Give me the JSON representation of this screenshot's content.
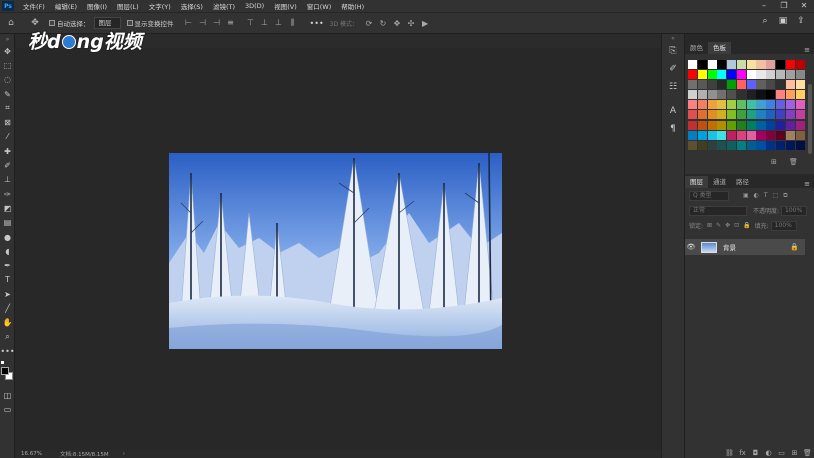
{
  "menubar": {
    "logo": "Ps",
    "items": [
      "文件(F)",
      "编辑(E)",
      "图像(I)",
      "图层(L)",
      "文字(Y)",
      "选择(S)",
      "滤镜(T)",
      "3D(D)",
      "视图(V)",
      "窗口(W)",
      "帮助(H)"
    ],
    "window_controls": [
      "–",
      "❐",
      "✕"
    ]
  },
  "options": {
    "auto_select_label": "自动选择：",
    "auto_select_value": "图层",
    "show_transform_label": "显示变换控件",
    "more": "•••",
    "mode_3d": "3D 模式："
  },
  "watermark": "秒d ng视频",
  "document": {
    "image_subject": "snowy-forest-photo"
  },
  "statusbar": {
    "zoom": "16.67%",
    "doc_info": "文档:8.15M/8.15M"
  },
  "panels": {
    "color_tabs": [
      "颜色",
      "色板"
    ],
    "color_active_tab": "色板",
    "layer_tabs": [
      "图层",
      "通道",
      "路径"
    ],
    "layer_active_tab": "图层",
    "kind_placeholder": "Q 类型",
    "blend_mode": "正常",
    "opacity_label": "不透明度:",
    "opacity_value": "100%",
    "lock_label": "锁定:",
    "fill_label": "填充:",
    "fill_value": "100%",
    "layer_name": "背景"
  },
  "swatch_colors": [
    [
      "#ffffff",
      "#000000",
      "#ffffff",
      "#000000",
      "#b0c8d8",
      "#c8e0a8",
      "#f8e0a0",
      "#f0c0a0",
      "#e0a0a0",
      "#000000",
      "#ff0000",
      "#c00000"
    ],
    [
      "#ff0000",
      "#ffff00",
      "#00ff00",
      "#00ffff",
      "#0000ff",
      "#ff00ff",
      "#ffffff",
      "#e8e8e8",
      "#d0d0d0",
      "#b8b8b8",
      "#a0a0a0",
      "#888888"
    ],
    [
      "#707070",
      "#585858",
      "#404040",
      "#282828",
      "#00a000",
      "#ff6060",
      "#6060ff",
      "#606060",
      "#484848",
      "#303030",
      "#ffc0a0",
      "#ffe0a0"
    ],
    [
      "#d0d0d0",
      "#b0b0b0",
      "#909090",
      "#707070",
      "#505050",
      "#303030",
      "#202020",
      "#101010",
      "#000000",
      "#ff8080",
      "#ffa060",
      "#ffd060"
    ],
    [
      "#ff8080",
      "#f08060",
      "#f0a040",
      "#e0c040",
      "#a0d040",
      "#60c060",
      "#40c0a0",
      "#40a0d0",
      "#4080e0",
      "#6060e0",
      "#a060e0",
      "#e060c0"
    ],
    [
      "#e05050",
      "#e07030",
      "#e09020",
      "#d0b020",
      "#80c020",
      "#40a040",
      "#20a080",
      "#2080c0",
      "#2060c0",
      "#4040c0",
      "#8040c0",
      "#c040a0"
    ],
    [
      "#c03030",
      "#c05010",
      "#c07000",
      "#b09000",
      "#60a000",
      "#208020",
      "#008060",
      "#0060a0",
      "#0040a0",
      "#2020a0",
      "#6020a0",
      "#a02080"
    ],
    [
      "#0080c0",
      "#00a0e0",
      "#20c0e0",
      "#40e0e0",
      "#c02060",
      "#e04080",
      "#e060a0",
      "#a00060",
      "#800040",
      "#600020",
      "#a08060",
      "#806040"
    ],
    [
      "#605030",
      "#404020",
      "#304040",
      "#205050",
      "#106060",
      "#008080",
      "#006090",
      "#0050a0",
      "#00308a",
      "#002070",
      "#001858",
      "#001040"
    ]
  ]
}
